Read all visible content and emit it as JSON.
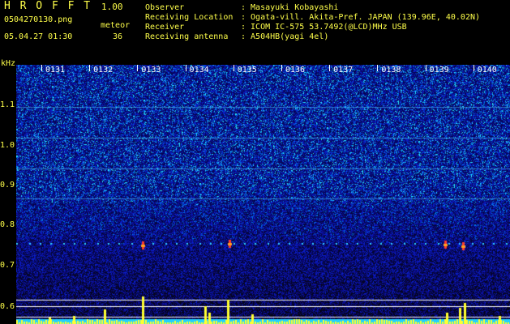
{
  "header": {
    "app_title": "H R O F F T",
    "app_version": "1.00",
    "file_name": "0504270130.png",
    "meteor_label": "meteor",
    "meteor_count": "36",
    "timestamp": "05.04.27 01:30",
    "info": [
      {
        "label": "Observer",
        "value": ": Masayuki Kobayashi"
      },
      {
        "label": "Receiving Location",
        "value": ": Ogata-vill. Akita-Pref. JAPAN (139.96E, 40.02N)"
      },
      {
        "label": "Receiver",
        "value": ": ICOM IC-575 53.7492(@LCD)MHz USB"
      },
      {
        "label": "Receiving antenna",
        "value": ": A504HB(yagi 4el)"
      }
    ]
  },
  "axis": {
    "y_unit": "kHz",
    "y_ticks": [
      "1.1",
      "1.0",
      "0.9",
      "0.8",
      "0.7",
      "0.6"
    ],
    "x_ticks": [
      "0131",
      "0132",
      "0133",
      "0134",
      "0135",
      "0136",
      "0137",
      "0138",
      "0139",
      "0140"
    ]
  },
  "colors": {
    "header_text": "#ffff4a",
    "background": "#000000",
    "tick_text": "#ffffff"
  }
}
